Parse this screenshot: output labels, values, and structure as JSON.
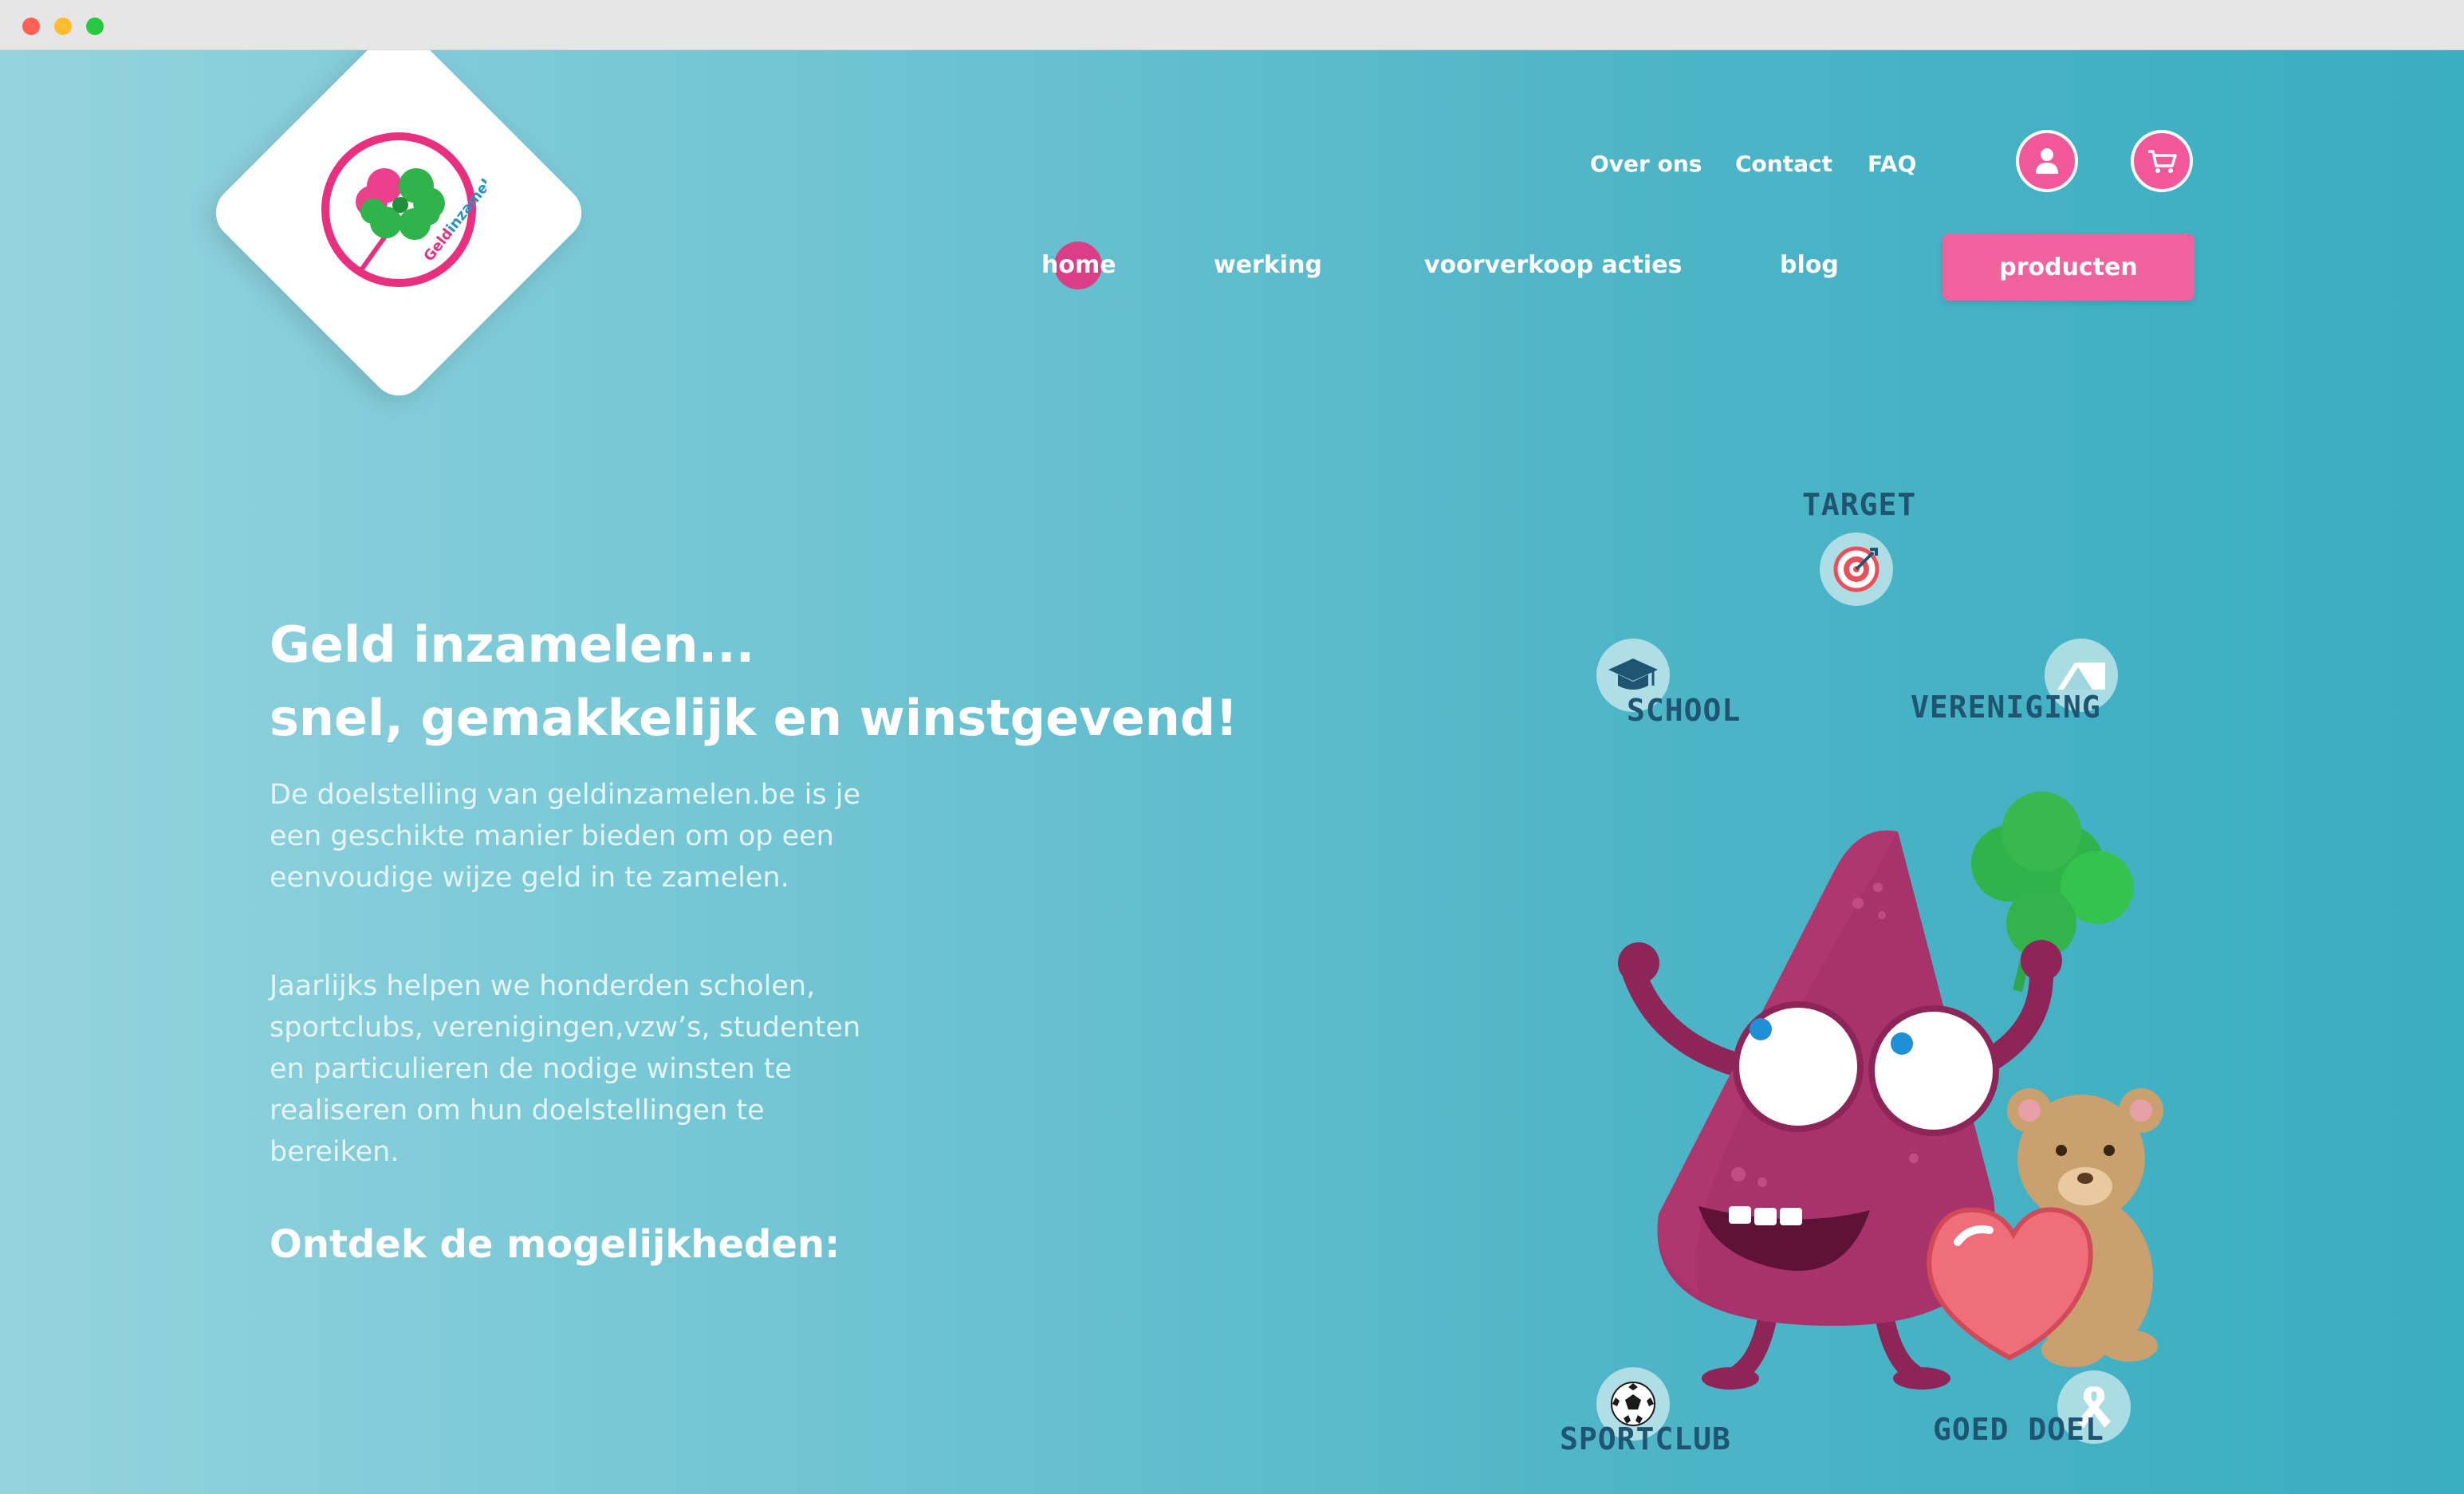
{
  "brand": {
    "logo_text_1": "Geld",
    "logo_text_2": "inzamelen",
    "colors": {
      "pink": "#f0589a",
      "green": "#2fb34a",
      "teal": "#3eb0c4",
      "navy": "#1f5472"
    }
  },
  "top_nav": {
    "items": [
      {
        "label": "Over ons"
      },
      {
        "label": "Contact"
      },
      {
        "label": "FAQ"
      }
    ],
    "account_icon": "user-icon",
    "cart_icon": "cart-icon"
  },
  "main_nav": {
    "items": [
      {
        "label": "Home",
        "active": true
      },
      {
        "label": "Werking"
      },
      {
        "label": "Voorverkoop acties"
      },
      {
        "label": "Blog"
      }
    ],
    "cta_label": "Producten"
  },
  "hero": {
    "headline_line1": "Geld inzamelen...",
    "headline_line2": "snel, gemakkelijk en winstgevend!",
    "paragraph1": "De doelstelling van geldinzamelen.be is je een geschikte manier bieden om op een eenvoudige wijze geld in te zamelen.",
    "paragraph2": "Jaarlijks helpen we honderden scholen, sportclubs, verenigingen,vzw’s, studenten en particulieren de nodige winsten te realiseren om hun doelstellingen te bereiken.",
    "discover": "Ontdek de mogelijkheden:"
  },
  "categories": {
    "target": {
      "label": "TARGET",
      "icon": "target-icon"
    },
    "school": {
      "label": "SCHOOL",
      "icon": "graduation-cap-icon"
    },
    "vereniging": {
      "label": "VERENIGING",
      "icon": "tent-icon"
    },
    "sportclub": {
      "label": "SPORTCLUB",
      "icon": "soccer-ball-icon"
    },
    "goed_doel": {
      "label": "GOED DOEL",
      "icon": "ribbon-icon"
    }
  }
}
